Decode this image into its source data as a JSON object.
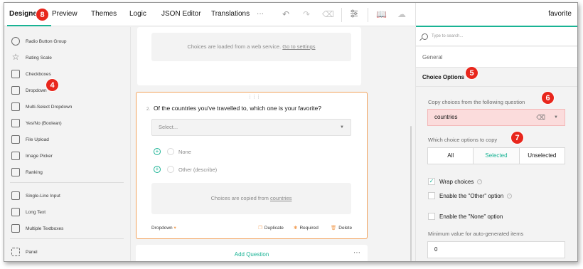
{
  "topbar": {
    "tabs": [
      {
        "label": "Designer",
        "active": true
      },
      {
        "label": "Preview"
      },
      {
        "label": "Themes"
      },
      {
        "label": "Logic"
      },
      {
        "label": "JSON Editor"
      },
      {
        "label": "Translations"
      }
    ],
    "more_label": "···",
    "right_title": "favorite",
    "icons": [
      "undo-icon",
      "redo-icon",
      "eraser-icon",
      "settings-icon",
      "book-icon",
      "cloud-icon"
    ]
  },
  "badges": {
    "b8": "8",
    "b4": "4",
    "b5": "5",
    "b6": "6",
    "b7": "7"
  },
  "toolbox": {
    "items": [
      {
        "label": "Radio Button Group",
        "icon": "radio-icon"
      },
      {
        "label": "Rating Scale",
        "icon": "star-icon"
      },
      {
        "label": "Checkboxes",
        "icon": "checkbox-icon"
      },
      {
        "label": "Dropdown",
        "icon": "dropdown-icon"
      },
      {
        "label": "Multi-Select Dropdown",
        "icon": "multi-dropdown-icon"
      },
      {
        "label": "Yes/No (Boolean)",
        "icon": "toggle-icon"
      },
      {
        "label": "File Upload",
        "icon": "folder-icon"
      },
      {
        "label": "Image Picker",
        "icon": "image-icon"
      },
      {
        "label": "Ranking",
        "icon": "ranking-icon"
      },
      {
        "label": "Single-Line Input",
        "icon": "input-icon"
      },
      {
        "label": "Long Text",
        "icon": "text-icon"
      },
      {
        "label": "Multiple Textboxes",
        "icon": "textboxes-icon"
      },
      {
        "label": "Panel",
        "icon": "panel-icon"
      }
    ]
  },
  "canvas": {
    "webservice_text": "Choices are loaded from a web service.",
    "webservice_link": "Go to settings",
    "question": {
      "number": "2.",
      "title": "Of the countries you've travelled to, which one is your favorite?",
      "select_placeholder": "Select...",
      "choices": [
        "None",
        "Other (describe)"
      ],
      "copied_text": "Choices are copied from",
      "copied_link": "countries",
      "type_label": "Dropdown",
      "actions": {
        "duplicate": "Duplicate",
        "required": "Required",
        "delete": "Delete"
      }
    },
    "add_question": "Add Question"
  },
  "props": {
    "search_placeholder": "Type to search...",
    "general": "General",
    "choice_options": "Choice Options",
    "copy_label": "Copy choices from the following question",
    "copy_value": "countries",
    "which_label": "Which choice options to copy",
    "segments": [
      "All",
      "Selected",
      "Unselected"
    ],
    "selected_segment": "Selected",
    "wrap_choices": "Wrap choices",
    "enable_other": "Enable the \"Other\" option",
    "enable_none": "Enable the \"None\" option",
    "min_label": "Minimum value for auto-generated items",
    "min_value": "0"
  },
  "colors": {
    "accent": "#19b394",
    "badge": "#e8261c",
    "focus": "#f2a25c",
    "error_bg": "#fbdcdc"
  }
}
